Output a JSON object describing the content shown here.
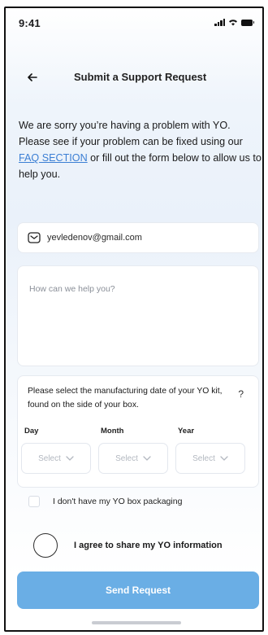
{
  "status_bar": {
    "time": "9:41"
  },
  "header": {
    "title": "Submit a Support Request",
    "back_icon": "arrow-left-icon"
  },
  "intro": {
    "text_before_link": "We are sorry you’re having a problem with YO. Please see if your problem can be fixed using our ",
    "link_text": "FAQ SECTION",
    "text_after_link": " or fill out the form below to allow us to help you."
  },
  "form": {
    "email_icon": "mail-icon",
    "email_value": "yevledenov@gmail.com",
    "help_placeholder": "How can we help you?",
    "date_question": "Please select the manufacturing date of your YO kit, found on the side of your box.",
    "help_icon_text": "?",
    "day_label": "Day",
    "month_label": "Month",
    "year_label": "Year",
    "day_select": "Select",
    "month_select": "Select",
    "year_select": "Select",
    "no_box_label": "I don't have my YO box packaging",
    "agree_label": "I agree to share my YO information",
    "send_button": "Send Request"
  },
  "colors": {
    "accent": "#6aaee5",
    "link": "#3b7fd4"
  }
}
